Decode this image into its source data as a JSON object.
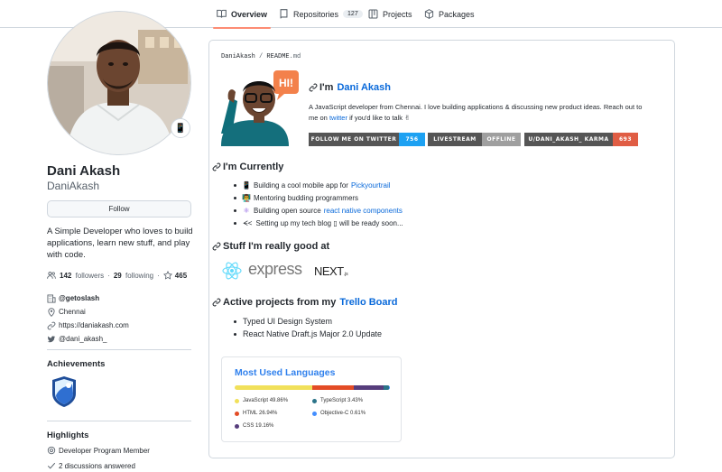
{
  "tabs": [
    {
      "label": "Overview",
      "icon": "book-icon",
      "active": true
    },
    {
      "label": "Repositories",
      "icon": "repo-icon",
      "count": "127"
    },
    {
      "label": "Projects",
      "icon": "project-icon"
    },
    {
      "label": "Packages",
      "icon": "package-icon"
    }
  ],
  "profile": {
    "status_emoji": "📱",
    "fullname": "Dani Akash",
    "login": "DaniAkash",
    "follow_label": "Follow",
    "bio": "A Simple Developer who loves to build applications, learn new stuff, and play with code.",
    "followers_count": "142",
    "followers_label": "followers",
    "following_count": "29",
    "following_label": "following",
    "stars_count": "465",
    "org": "@getoslash",
    "location": "Chennai",
    "website": "https://daniakash.com",
    "twitter": "@dani_akash_"
  },
  "achievements": {
    "title": "Achievements"
  },
  "highlights": {
    "title": "Highlights",
    "items": [
      "Developer Program Member",
      "2 discussions answered"
    ]
  },
  "readme": {
    "crumb_user": "DaniAkash",
    "crumb_sep": " / ",
    "crumb_file": "README",
    "crumb_ext": ".md",
    "hi_bubble": "HI!",
    "greeting_prefix": "I'm",
    "greeting_name": "Dani Akash",
    "intro_a": "A JavaScript developer from Chennai. I love building applications & discussing new product ideas. Reach out to me on",
    "intro_link": "twitter",
    "intro_b": "if you'd like to talk ✌",
    "shields": [
      {
        "label": "FOLLOW ME ON TWITTER",
        "value": "756",
        "label_color": "#555555",
        "value_color": "#1da1f2"
      },
      {
        "label": "LIVESTREAM",
        "value": "OFFLINE",
        "label_color": "#555555",
        "value_color": "#9f9f9f"
      },
      {
        "label": "U/DANI_AKASH_ KARMA",
        "value": "693",
        "label_color": "#555555",
        "value_color": "#e05d44"
      }
    ],
    "currently_title": "I'm Currently",
    "currently": [
      {
        "icon": "📱",
        "text": "Building a cool mobile app for",
        "link": "Pickyourtrail"
      },
      {
        "icon": "👨‍🏫",
        "text": "Mentoring budding programmers",
        "link": ""
      },
      {
        "icon": "⚛",
        "text": "Building open source",
        "link": "react native components"
      },
      {
        "icon": "ᗕ<",
        "text": "Setting up my tech blog ▯ will be ready soon...",
        "link": ""
      }
    ],
    "good_title": "Stuff I'm really good at",
    "tech": {
      "express": "express",
      "next": "NEXT",
      "next_suffix": ".js"
    },
    "projects_title_prefix": "Active projects from my",
    "projects_title_link": "Trello Board",
    "projects": [
      "Typed UI Design System",
      "React Native Draft.js Major 2.0 Update"
    ],
    "languages_title": "Most Used Languages",
    "languages": [
      {
        "name": "JavaScript",
        "pct": "49.86%",
        "value": 49.86,
        "color": "#f1e05a"
      },
      {
        "name": "TypeScript",
        "pct": "3.43%",
        "value": 3.43,
        "color": "#2b7489"
      },
      {
        "name": "HTML",
        "pct": "26.94%",
        "value": 26.94,
        "color": "#e34c26"
      },
      {
        "name": "Objective-C",
        "pct": "0.61%",
        "value": 0.61,
        "color": "#438eff"
      },
      {
        "name": "CSS",
        "pct": "19.16%",
        "value": 19.16,
        "color": "#563d7c"
      }
    ]
  }
}
